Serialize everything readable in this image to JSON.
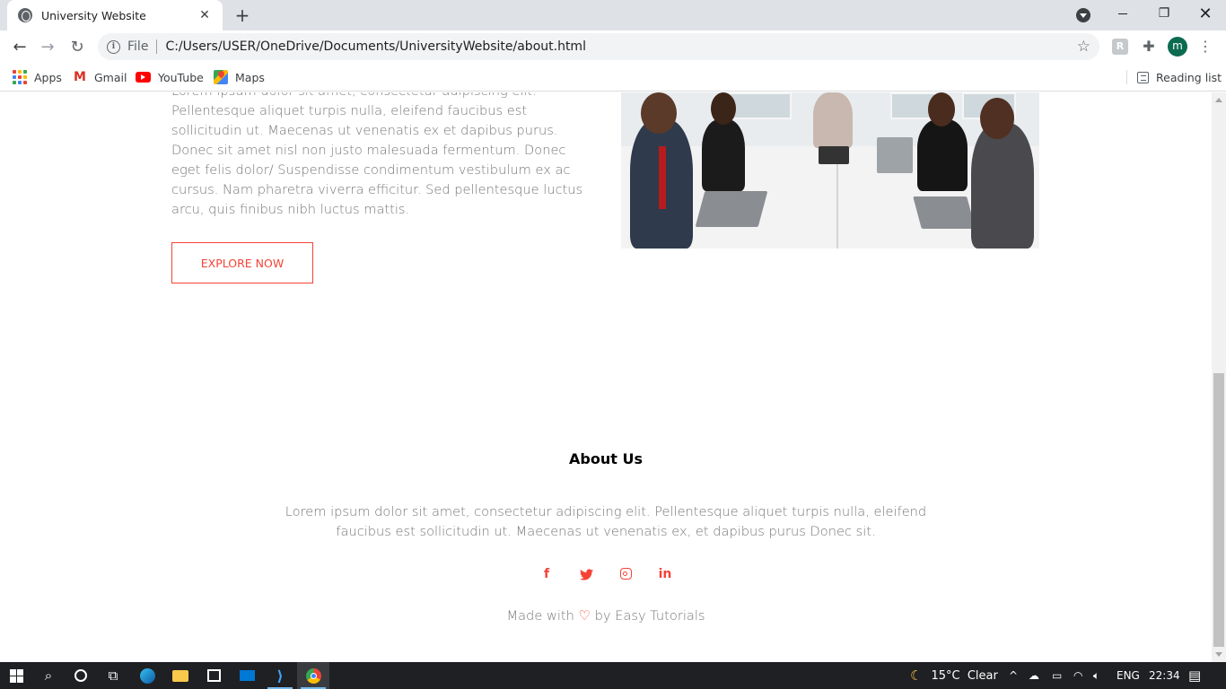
{
  "browser": {
    "tab_title": "University Website",
    "close_glyph": "✕",
    "new_tab_glyph": "+",
    "scheme_label": "File",
    "url": "C:/Users/USER/OneDrive/Documents/UniversityWebsite/about.html",
    "profile_initial": "m",
    "bookmarks": [
      {
        "label": "Apps",
        "icon": "apps-grid-icon"
      },
      {
        "label": "Gmail",
        "icon": "gmail-icon"
      },
      {
        "label": "YouTube",
        "icon": "youtube-icon"
      },
      {
        "label": "Maps",
        "icon": "maps-icon"
      }
    ],
    "reading_list": "Reading list"
  },
  "page": {
    "intro_paragraph": "Lorem ipsum dolor sit amet, consectetur adipiscing elit. Pellentesque aliquet turpis nulla, eleifend faucibus est sollicitudin ut. Maecenas ut venenatis ex et dapibus purus. Donec sit amet nisl non justo malesuada fermentum. Donec eget felis dolor/ Suspendisse condimentum vestibulum ex ac cursus. Nam pharetra viverra efficitur. Sed pellentesque luctus arcu, quis finibus nibh luctus mattis.",
    "explore_button": "EXPLORE NOW",
    "footer": {
      "title": "About Us",
      "text": "Lorem ipsum dolor sit amet, consectetur adipiscing elit. Pellentesque aliquet turpis nulla, eleifend faucibus est sollicitudin ut. Maecenas ut venenatis ex, et dapibus purus Donec sit.",
      "socials": [
        "facebook-icon",
        "twitter-icon",
        "instagram-icon",
        "linkedin-icon"
      ],
      "made_with_prefix": "Made with",
      "made_with_suffix": "by Easy Tutorials"
    }
  },
  "taskbar": {
    "weather": "15°C  Clear",
    "language": "ENG",
    "time": "22:34"
  },
  "colors": {
    "accent": "#f44336",
    "body_text": "#777777",
    "taskbar_bg": "#1f2023"
  }
}
